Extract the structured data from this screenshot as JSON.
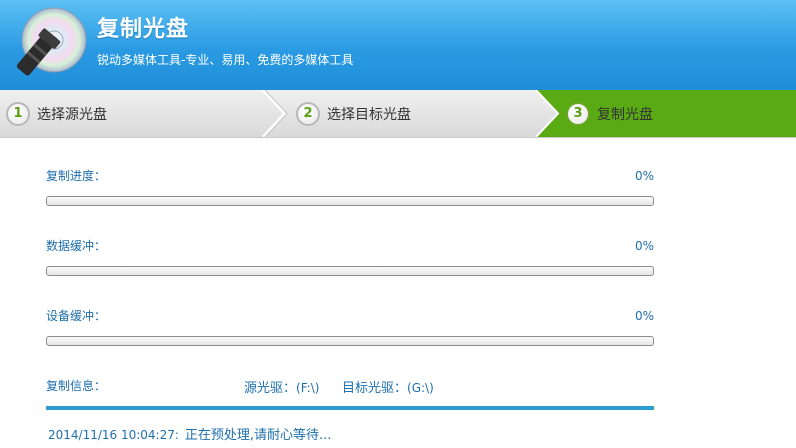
{
  "app": {
    "title": "复制光盘",
    "subtitle": "锐动多媒体工具-专业、易用、免费的多媒体工具"
  },
  "steps": [
    {
      "num": "1",
      "label": "选择源光盘",
      "state": "done"
    },
    {
      "num": "2",
      "label": "选择目标光盘",
      "state": "done"
    },
    {
      "num": "3",
      "label": "复制光盘",
      "state": "active"
    }
  ],
  "progress": {
    "copy": {
      "label": "复制进度：",
      "percent_text": "0%",
      "value": 0
    },
    "data_buffer": {
      "label": "数据缓冲：",
      "percent_text": "0%",
      "value": 0
    },
    "device_buffer": {
      "label": "设备缓冲：",
      "percent_text": "0%",
      "value": 0
    }
  },
  "info": {
    "label": "复制信息：",
    "source_label": "源光驱：",
    "source_value": "(F:\\)",
    "target_label": "目标光驱：",
    "target_value": "(G:\\)"
  },
  "log": [
    {
      "time": "2014/11/16 10:04:27:",
      "message": "正在预处理,请耐心等待..."
    }
  ],
  "colors": {
    "header_blue": "#2a9be3",
    "active_step_green": "#5aaa14",
    "text_blue": "#1e6fae"
  },
  "icons": {
    "logo": "disc-with-flashlight-icon"
  }
}
